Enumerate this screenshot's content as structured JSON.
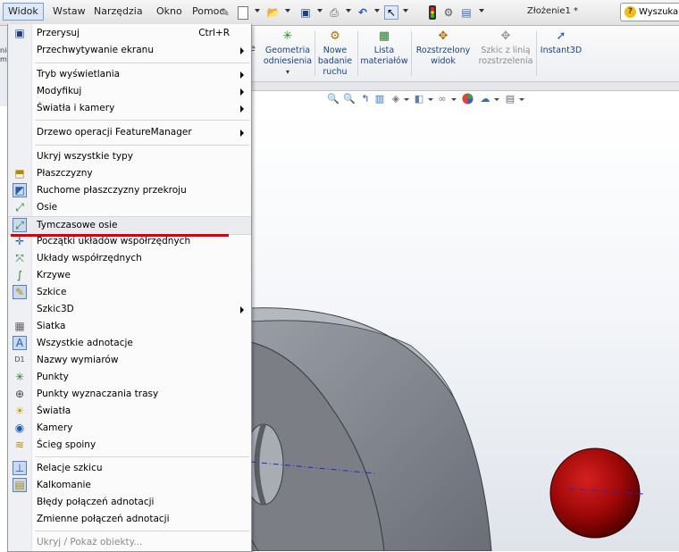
{
  "menubar": {
    "items": [
      {
        "label": "Widok"
      },
      {
        "label": "Wstaw"
      },
      {
        "label": "Narzędzia"
      },
      {
        "label": "Okno"
      },
      {
        "label": "Pomoc"
      }
    ],
    "doc_title": "Złożenie1 *",
    "search_label": "Wyszuka"
  },
  "ribbon": {
    "left_fragments": {
      "a": "nic",
      "b": "mp",
      "c": "e"
    },
    "buttons": [
      {
        "label1": "Geometria",
        "label2": "odniesienia",
        "icon": "axis-icon"
      },
      {
        "label1": "Nowe",
        "label2": "badanie",
        "label3": "ruchu",
        "icon": "motion-icon"
      },
      {
        "label1": "Lista",
        "label2": "materiałów",
        "icon": "bom-icon"
      },
      {
        "label1": "Rozstrzelony",
        "label2": "widok",
        "icon": "explode-icon"
      },
      {
        "label1": "Szkic z linią",
        "label2": "rozstrzelenia",
        "icon": "explode-sketch-icon",
        "disabled": true
      },
      {
        "label1": "Instant3D",
        "icon": "instant3d-icon"
      }
    ]
  },
  "menu": {
    "items": [
      {
        "label": "Przerysuj",
        "shortcut": "Ctrl+R",
        "icon": "redraw-icon"
      },
      {
        "label": "Przechwytywanie ekranu",
        "submenu": true
      },
      {
        "label": "Tryb wyświetlania",
        "submenu": true
      },
      {
        "label": "Modyfikuj",
        "submenu": true
      },
      {
        "label": "Światła i kamery",
        "submenu": true
      },
      {
        "label": "Drzewo operacji FeatureManager",
        "submenu": true
      },
      {
        "label": "Ukryj wszystkie typy"
      },
      {
        "label": "Płaszczyzny",
        "icon": "planes-icon"
      },
      {
        "label": "Ruchome płaszczyzny przekroju",
        "icon": "section-planes-icon",
        "boxed": true
      },
      {
        "label": "Osie",
        "icon": "axes-icon"
      },
      {
        "label": "Tymczasowe osie",
        "icon": "temp-axes-icon",
        "boxed": true,
        "highlighted": true
      },
      {
        "label": "Początki układów współrzędnych",
        "icon": "origins-icon"
      },
      {
        "label": "Układy współrzędnych",
        "icon": "coordinate-systems-icon"
      },
      {
        "label": "Krzywe",
        "icon": "curves-icon"
      },
      {
        "label": "Szkice",
        "icon": "sketches-icon",
        "boxed": true
      },
      {
        "label": "Szkic3D",
        "submenu": true
      },
      {
        "label": "Siatka",
        "icon": "grid-icon"
      },
      {
        "label": "Wszystkie adnotacje",
        "icon": "annotations-icon",
        "boxed": true
      },
      {
        "label": "Nazwy wymiarów",
        "icon": "dimension-names-icon"
      },
      {
        "label": "Punkty",
        "icon": "points-icon"
      },
      {
        "label": "Punkty wyznaczania trasy",
        "icon": "route-points-icon"
      },
      {
        "label": "Światła",
        "icon": "lights-icon"
      },
      {
        "label": "Kamery",
        "icon": "cameras-icon"
      },
      {
        "label": "Ścieg spoiny",
        "icon": "weld-bead-icon"
      },
      {
        "label": "Relacje szkicu",
        "icon": "sketch-relations-icon",
        "boxed": true
      },
      {
        "label": "Kalkomanie",
        "icon": "decals-icon",
        "boxed": true
      },
      {
        "label": "Błędy połączeń adnotacji"
      },
      {
        "label": "Zmienne połączeń adnotacji"
      },
      {
        "label": "Ukryj / Pokaż obiekty...",
        "disabled": true
      }
    ]
  },
  "colors": {
    "highlight_underline": "#e00000",
    "sphere": "#b01010",
    "part_gray": "#8c8f96"
  }
}
